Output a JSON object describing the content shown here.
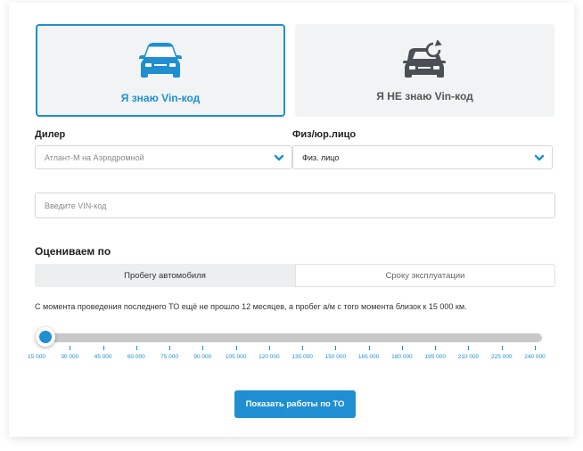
{
  "options": {
    "known_label": "Я знаю Vin-код",
    "unknown_label": "Я НЕ знаю Vin-код",
    "known_icon": "car-front-icon",
    "unknown_icon": "car-refresh-icon",
    "selected": "known"
  },
  "dealer": {
    "label": "Дилер",
    "value": "Атлант-М на Аэродромной"
  },
  "entity": {
    "label": "Физ/юр.лицо",
    "value": "Физ. лицо"
  },
  "vin": {
    "placeholder": "Введите VIN-код",
    "value": ""
  },
  "evaluate": {
    "title": "Оцениваем по",
    "tabs": [
      {
        "label": "Пробегу автомобиля",
        "active": true
      },
      {
        "label": "Сроку эксплуатации",
        "active": false
      }
    ]
  },
  "info_text": "С момента проведения последнего ТО ещё не прошло 12 месяцев, а пробег а/м с того момента близок к 15 000 км.",
  "slider": {
    "value": "15 000",
    "ticks": [
      "15 000",
      "30 000",
      "45 000",
      "60 000",
      "75 000",
      "90 000",
      "105 000",
      "120 000",
      "135 000",
      "150 000",
      "165 000",
      "180 000",
      "195 000",
      "210 000",
      "225 000",
      "240 000"
    ]
  },
  "submit_label": "Показать работы по ТО",
  "colors": {
    "accent": "#1f8fd1",
    "tile_bg": "#f1f3f4",
    "unknown_icon": "#4a4f55"
  }
}
